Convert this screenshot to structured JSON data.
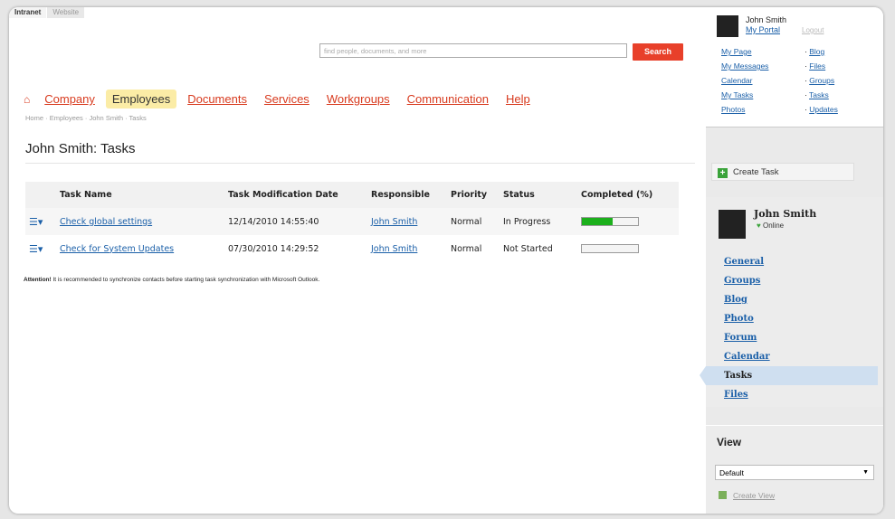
{
  "top_tabs": [
    "Intranet",
    "Website"
  ],
  "search": {
    "placeholder": "find people, documents, and more",
    "button": "Search"
  },
  "nav": {
    "home_icon": "home-icon",
    "items": [
      "Company",
      "Employees",
      "Documents",
      "Services",
      "Workgroups",
      "Communication",
      "Help"
    ],
    "active": "Employees"
  },
  "breadcrumb": [
    "Home",
    "Employees",
    "John Smith",
    "Tasks"
  ],
  "page_title": "John Smith: Tasks",
  "table": {
    "headers": [
      "Task Name",
      "Task Modification Date",
      "Responsible",
      "Priority",
      "Status",
      "Completed (%)"
    ],
    "rows": [
      {
        "name": "Check global settings",
        "date": "12/14/2010 14:55:40",
        "responsible": "John Smith",
        "priority": "Normal",
        "status": "In Progress",
        "completed": 0.55
      },
      {
        "name": "Check for System Updates",
        "date": "07/30/2010 14:29:52",
        "responsible": "John Smith",
        "priority": "Normal",
        "status": "Not Started",
        "completed": 0
      }
    ]
  },
  "attention": {
    "label": "Attention!",
    "text": " It is recommended to synchronize contacts before starting task synchronization with Microsoft Outlook."
  },
  "sidebar": {
    "user": {
      "name": "John Smith",
      "portal": "My Portal",
      "logout": "Logout"
    },
    "links_left": [
      "My Page",
      "My Messages",
      "Calendar",
      "My Tasks",
      "Photos"
    ],
    "links_right": [
      "Blog",
      "Files",
      "Groups",
      "Tasks",
      "Updates"
    ],
    "create_task": "Create Task",
    "profile": {
      "name": "John Smith",
      "status": "Online",
      "links": [
        "General",
        "Groups",
        "Blog",
        "Photo",
        "Forum",
        "Calendar",
        "Tasks",
        "Files"
      ],
      "active": "Tasks"
    },
    "view": {
      "title": "View",
      "selected": "Default",
      "create_view": "Create View"
    }
  },
  "colors": {
    "accent_red": "#d83a1e",
    "link_blue": "#1a5fa8",
    "progress_green": "#1cb01c",
    "active_tab_bg": "#fbeca6"
  }
}
